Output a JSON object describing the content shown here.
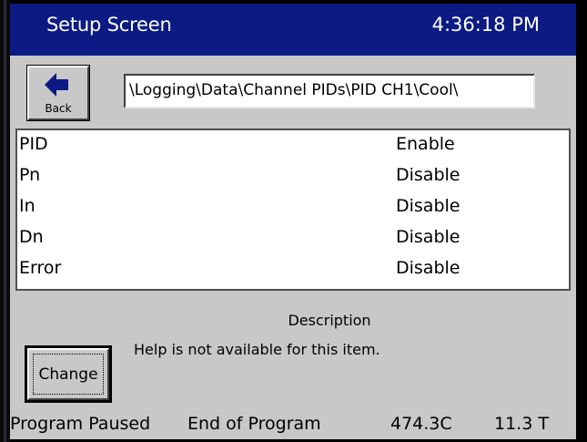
{
  "window": {
    "title": "Setup Screen",
    "clock": "4:36:18 PM"
  },
  "toolbar": {
    "back_label": "Back",
    "back_icon": "left-arrow-icon",
    "path": "\\Logging\\Data\\Channel PIDs\\PID CH1\\Cool\\"
  },
  "list": {
    "rows": [
      {
        "name": "PID",
        "value": "Enable"
      },
      {
        "name": "Pn",
        "value": "Disable"
      },
      {
        "name": "In",
        "value": "Disable"
      },
      {
        "name": "Dn",
        "value": "Disable"
      },
      {
        "name": "Error",
        "value": "Disable"
      }
    ]
  },
  "description": {
    "title": "Description",
    "text": "Help is not available for this item."
  },
  "actions": {
    "change_label": "Change"
  },
  "status": {
    "program_state": "Program Paused",
    "program_step": "End of Program",
    "temperature": "474.3C",
    "time": "11.3 T"
  },
  "colors": {
    "titlebar": "#0c1a84",
    "background": "#c8c8c8",
    "icon_arrow": "#0c1a84"
  }
}
